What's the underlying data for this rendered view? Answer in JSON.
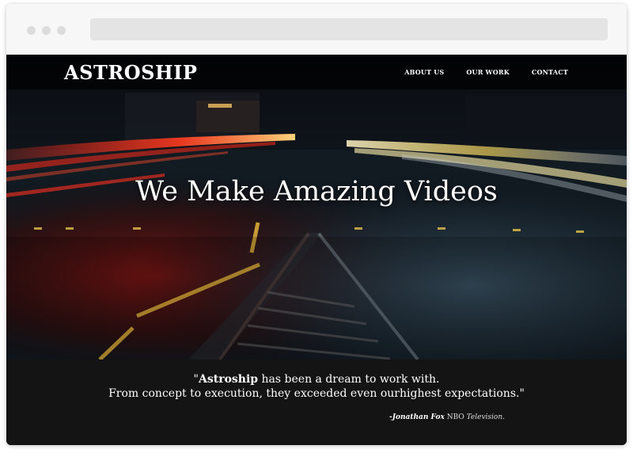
{
  "browser": {
    "address_bar": ""
  },
  "site": {
    "logo": "ASTROSHIP",
    "nav": [
      {
        "label": "ABOUT US"
      },
      {
        "label": "OUR WORK"
      },
      {
        "label": "CONTACT"
      }
    ]
  },
  "hero": {
    "headline": "We Make Amazing Videos"
  },
  "testimonial": {
    "quote_open": "\"",
    "quote_brand": "Astroship",
    "quote_line1_rest": " has been a dream to work with.",
    "quote_line2": "From concept to execution, they exceeded even ourhighest expectations.\"",
    "author": "-Jonathan Fox",
    "org_prefix": "NBO",
    "org_suffix": "Television."
  },
  "colors": {
    "testimonial_bg": "#141414",
    "nav_bg": "#000000",
    "text": "#ffffff"
  }
}
